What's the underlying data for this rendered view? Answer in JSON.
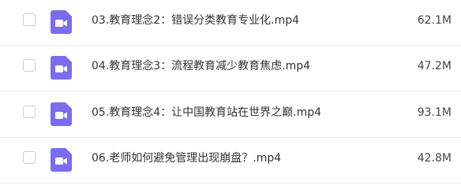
{
  "colors": {
    "video_icon": "#7a6cf0",
    "checkbox_border": "#c9ced6",
    "divider": "#eef0f4"
  },
  "files": [
    {
      "name": "03.教育理念2：错误分类教育专业化.mp4",
      "size": "62.1M",
      "icon": "video-file-icon",
      "checked": false
    },
    {
      "name": "04.教育理念3：流程教育减少教育焦虑.mp4",
      "size": "47.2M",
      "icon": "video-file-icon",
      "checked": false
    },
    {
      "name": "05.教育理念4：让中国教育站在世界之巅.mp4",
      "size": "93.1M",
      "icon": "video-file-icon",
      "checked": false
    },
    {
      "name": "06.老师如何避免管理出现崩盘？.mp4",
      "size": "42.8M",
      "icon": "video-file-icon",
      "checked": false
    }
  ]
}
